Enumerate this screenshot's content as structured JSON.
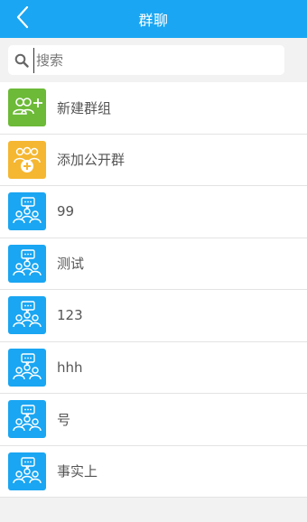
{
  "header": {
    "title": "群聊",
    "back_icon": "back-arrow-icon"
  },
  "search": {
    "placeholder": "搜索",
    "value": "",
    "icon": "search-icon"
  },
  "actions": [
    {
      "label": "新建群组",
      "icon": "new-group-icon",
      "color": "#6cba37"
    },
    {
      "label": "添加公开群",
      "icon": "add-public-group-icon",
      "color": "#f5b731"
    }
  ],
  "groups": [
    {
      "label": "99",
      "icon": "group-chat-icon",
      "color": "#1aa6f2"
    },
    {
      "label": "测试",
      "icon": "group-chat-icon",
      "color": "#1aa6f2"
    },
    {
      "label": "123",
      "icon": "group-chat-icon",
      "color": "#1aa6f2"
    },
    {
      "label": "hhh",
      "icon": "group-chat-icon",
      "color": "#1aa6f2"
    },
    {
      "label": "号",
      "icon": "group-chat-icon",
      "color": "#1aa6f2"
    },
    {
      "label": "事实上",
      "icon": "group-chat-icon",
      "color": "#1aa6f2"
    }
  ],
  "colors": {
    "header": "#1aa6f2",
    "background": "#f2f2f2",
    "divider": "#e3e3e3"
  }
}
